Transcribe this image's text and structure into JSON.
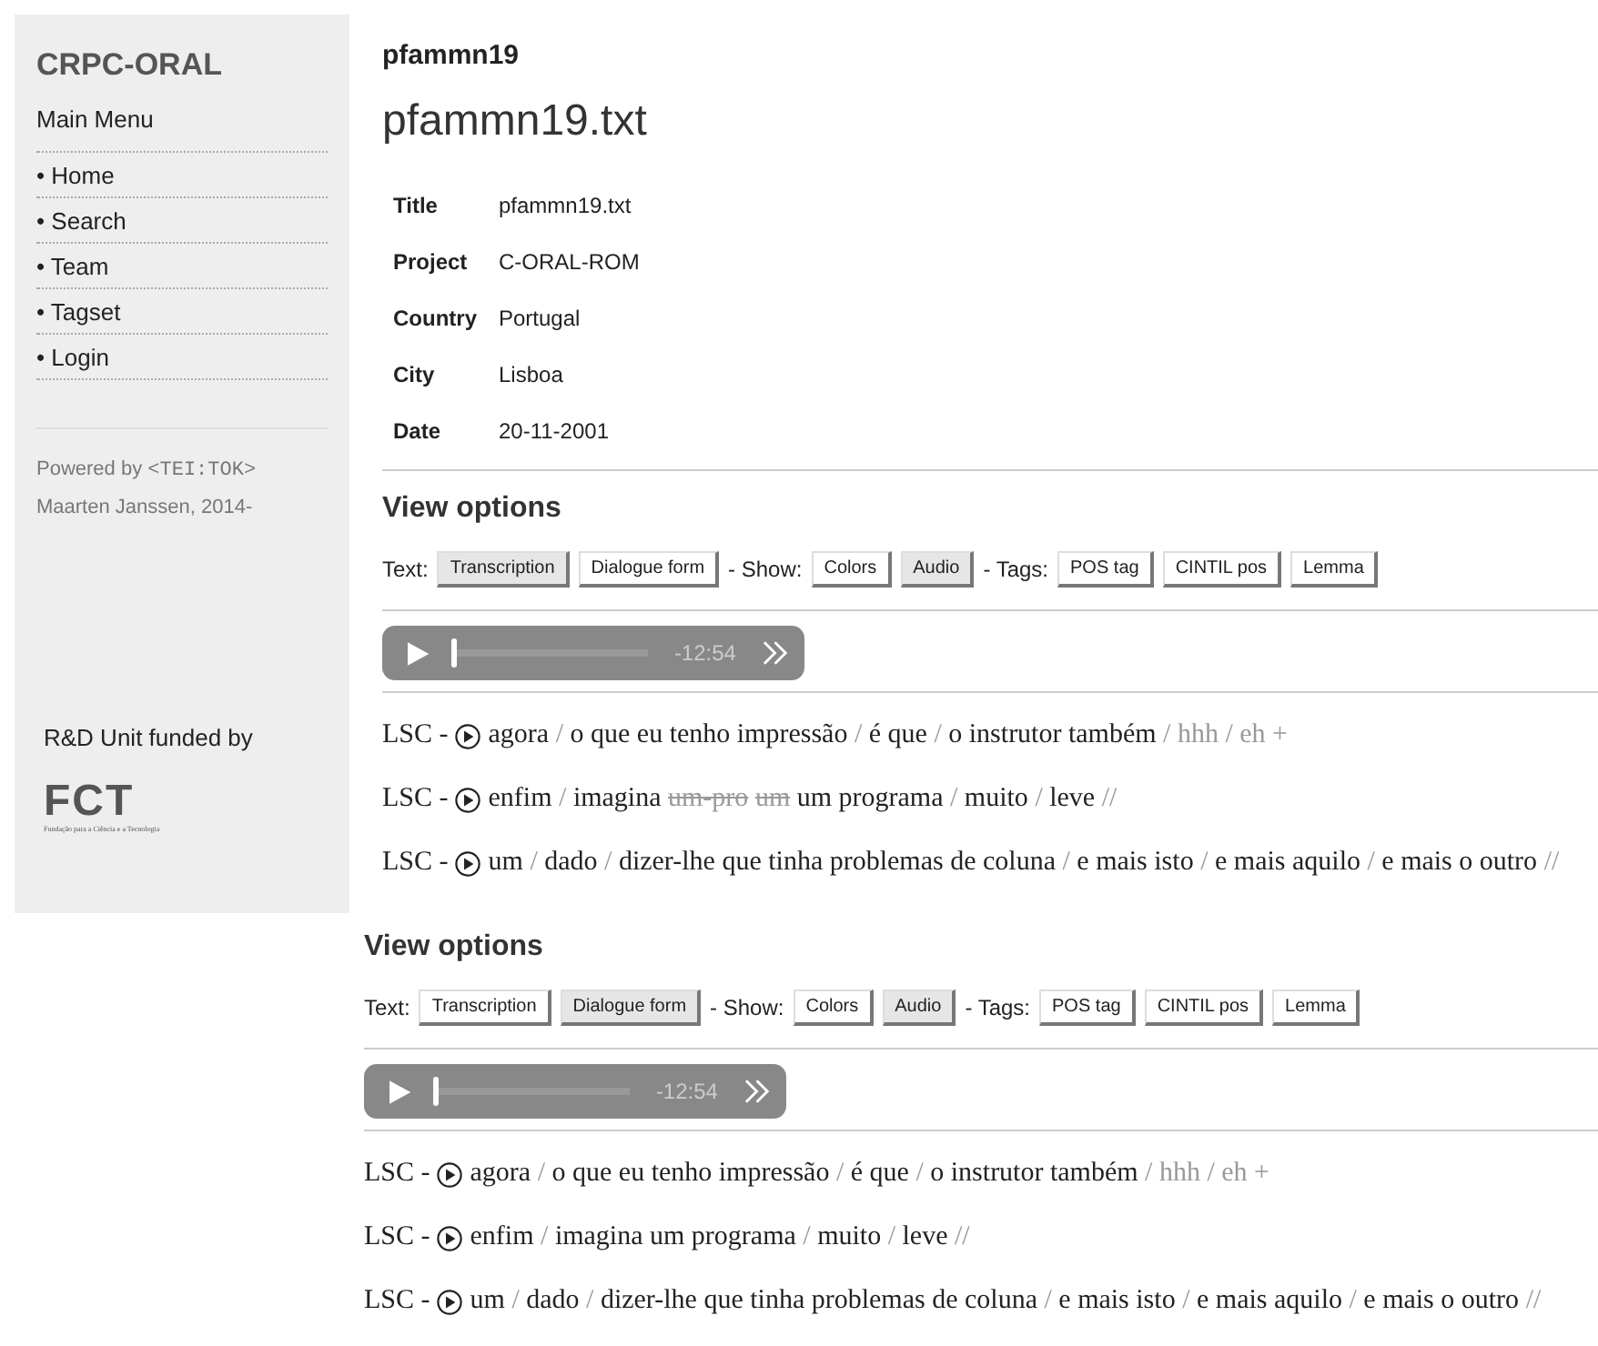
{
  "sidebar": {
    "site_title": "CRPC-ORAL",
    "menu_title": "Main Menu",
    "menu": [
      {
        "label": "• Home"
      },
      {
        "label": "• Search"
      },
      {
        "label": "• Team"
      },
      {
        "label": "• Tagset"
      },
      {
        "label": "• Login"
      }
    ],
    "powered_by": "Powered by",
    "powered_tag": "<TEI:TOK>",
    "author": "Maarten Janssen, 2014-",
    "funding": "R&D Unit funded by",
    "logo": "FCT",
    "logo_caption": "Fundação para a Ciência e a Tecnologia"
  },
  "page": {
    "heading": "pfammn19",
    "title": "pfammn19.txt",
    "metadata": [
      {
        "label": "Title",
        "value": "pfammn19.txt"
      },
      {
        "label": "Project",
        "value": "C-ORAL-ROM"
      },
      {
        "label": "Country",
        "value": "Portugal"
      },
      {
        "label": "City",
        "value": "Lisboa"
      },
      {
        "label": "Date",
        "value": "20-11-2001"
      }
    ]
  },
  "views": [
    {
      "title": "View options",
      "groups": [
        {
          "label": "Text:",
          "buttons": [
            {
              "label": "Transcription",
              "selected": true
            },
            {
              "label": "Dialogue form",
              "selected": false
            }
          ]
        },
        {
          "label": "- Show:",
          "buttons": [
            {
              "label": "Colors",
              "selected": false
            },
            {
              "label": "Audio",
              "selected": true
            }
          ]
        },
        {
          "label": "- Tags:",
          "buttons": [
            {
              "label": "POS tag",
              "selected": false
            },
            {
              "label": "CINTIL pos",
              "selected": false
            },
            {
              "label": "Lemma",
              "selected": false
            }
          ]
        }
      ],
      "player": {
        "time": "-12:54",
        "level": 0
      },
      "lines": [
        {
          "speaker": "LSC -",
          "tokens": [
            {
              "text": "agora",
              "kind": "word"
            },
            {
              "text": "/",
              "kind": "sep"
            },
            {
              "text": "o que eu tenho impressão",
              "kind": "word"
            },
            {
              "text": "/",
              "kind": "sep"
            },
            {
              "text": "é que",
              "kind": "word"
            },
            {
              "text": "/",
              "kind": "sep"
            },
            {
              "text": "o instrutor também",
              "kind": "word"
            },
            {
              "text": "/",
              "kind": "sep"
            },
            {
              "text": "hhh",
              "kind": "pause"
            },
            {
              "text": "/",
              "kind": "sep"
            },
            {
              "text": "eh +",
              "kind": "pause"
            }
          ]
        },
        {
          "speaker": "LSC -",
          "tokens": [
            {
              "text": "enfim",
              "kind": "word"
            },
            {
              "text": "/",
              "kind": "sep"
            },
            {
              "text": "imagina",
              "kind": "word"
            },
            {
              "text": "um-pro",
              "kind": "struck"
            },
            {
              "text": "um",
              "kind": "struck"
            },
            {
              "text": "um programa",
              "kind": "word"
            },
            {
              "text": "/",
              "kind": "sep"
            },
            {
              "text": "muito",
              "kind": "word"
            },
            {
              "text": "/",
              "kind": "sep"
            },
            {
              "text": "leve",
              "kind": "word"
            },
            {
              "text": "//",
              "kind": "sep"
            }
          ]
        },
        {
          "speaker": "LSC -",
          "tokens": [
            {
              "text": "um",
              "kind": "word"
            },
            {
              "text": "/",
              "kind": "sep"
            },
            {
              "text": "dado",
              "kind": "word"
            },
            {
              "text": "/",
              "kind": "sep"
            },
            {
              "text": "dizer-lhe que tinha problemas de coluna",
              "kind": "word"
            },
            {
              "text": "/",
              "kind": "sep"
            },
            {
              "text": "e mais isto",
              "kind": "word"
            },
            {
              "text": "/",
              "kind": "sep"
            },
            {
              "text": "e mais aquilo",
              "kind": "word"
            },
            {
              "text": "/",
              "kind": "sep"
            },
            {
              "text": "e mais o outro",
              "kind": "word"
            },
            {
              "text": "//",
              "kind": "sep"
            }
          ]
        }
      ]
    },
    {
      "title": "View options",
      "groups": [
        {
          "label": "Text:",
          "buttons": [
            {
              "label": "Transcription",
              "selected": false
            },
            {
              "label": "Dialogue form",
              "selected": true
            }
          ]
        },
        {
          "label": "- Show:",
          "buttons": [
            {
              "label": "Colors",
              "selected": false
            },
            {
              "label": "Audio",
              "selected": true
            }
          ]
        },
        {
          "label": "- Tags:",
          "buttons": [
            {
              "label": "POS tag",
              "selected": false
            },
            {
              "label": "CINTIL pos",
              "selected": false
            },
            {
              "label": "Lemma",
              "selected": false
            }
          ]
        }
      ],
      "player": {
        "time": "-12:54",
        "level": 0
      },
      "lines": [
        {
          "speaker": "LSC -",
          "tokens": [
            {
              "text": "agora",
              "kind": "word"
            },
            {
              "text": "/",
              "kind": "sep"
            },
            {
              "text": "o que eu tenho impressão",
              "kind": "word"
            },
            {
              "text": "/",
              "kind": "sep"
            },
            {
              "text": "é que",
              "kind": "word"
            },
            {
              "text": "/",
              "kind": "sep"
            },
            {
              "text": "o instrutor também",
              "kind": "word"
            },
            {
              "text": "/",
              "kind": "sep"
            },
            {
              "text": "hhh",
              "kind": "pause"
            },
            {
              "text": "/",
              "kind": "sep"
            },
            {
              "text": "eh +",
              "kind": "pause"
            }
          ]
        },
        {
          "speaker": "LSC -",
          "tokens": [
            {
              "text": "enfim",
              "kind": "word"
            },
            {
              "text": "/",
              "kind": "sep"
            },
            {
              "text": "imagina um programa",
              "kind": "word"
            },
            {
              "text": "/",
              "kind": "sep"
            },
            {
              "text": "muito",
              "kind": "word"
            },
            {
              "text": "/",
              "kind": "sep"
            },
            {
              "text": "leve",
              "kind": "word"
            },
            {
              "text": "//",
              "kind": "sep"
            }
          ]
        },
        {
          "speaker": "LSC -",
          "tokens": [
            {
              "text": "um",
              "kind": "word"
            },
            {
              "text": "/",
              "kind": "sep"
            },
            {
              "text": "dado",
              "kind": "word"
            },
            {
              "text": "/",
              "kind": "sep"
            },
            {
              "text": "dizer-lhe que tinha problemas de coluna",
              "kind": "word"
            },
            {
              "text": "/",
              "kind": "sep"
            },
            {
              "text": "e mais isto",
              "kind": "word"
            },
            {
              "text": "/",
              "kind": "sep"
            },
            {
              "text": "e mais aquilo",
              "kind": "word"
            },
            {
              "text": "/",
              "kind": "sep"
            },
            {
              "text": "e mais o outro",
              "kind": "word"
            },
            {
              "text": "//",
              "kind": "sep"
            }
          ]
        }
      ]
    }
  ]
}
